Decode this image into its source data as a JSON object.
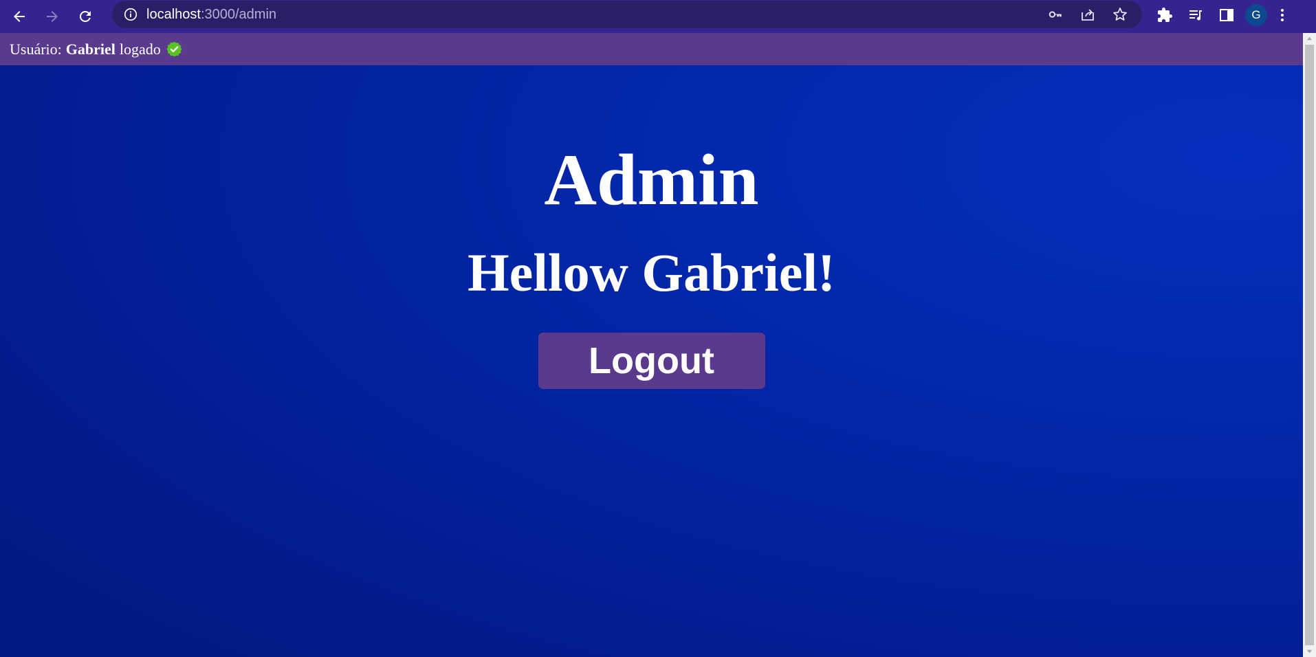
{
  "browser": {
    "url_host": "localhost",
    "url_path": ":3000/admin",
    "profile_initial": "G",
    "icons": {
      "back": "arrow-left-icon",
      "forward": "arrow-right-icon",
      "reload": "reload-icon",
      "site_info": "info-icon",
      "password": "key-icon",
      "share": "share-icon",
      "bookmark": "star-icon",
      "extensions": "puzzle-icon",
      "media": "media-queue-icon",
      "side_panel": "side-panel-icon",
      "menu": "more-vert-icon"
    }
  },
  "status_bar": {
    "prefix": "Usuário:",
    "user_name": "Gabriel",
    "suffix": "logado",
    "badge_icon": "check-badge-icon",
    "badge_color": "#58c322"
  },
  "main": {
    "title": "Admin",
    "greeting": "Hellow Gabriel!",
    "logout_label": "Logout"
  },
  "colors": {
    "chrome": "#35248f",
    "omnibox": "#2a1f66",
    "status_bar": "#5a3a8c",
    "background": "#0328ad",
    "button": "#5a3a8c"
  }
}
